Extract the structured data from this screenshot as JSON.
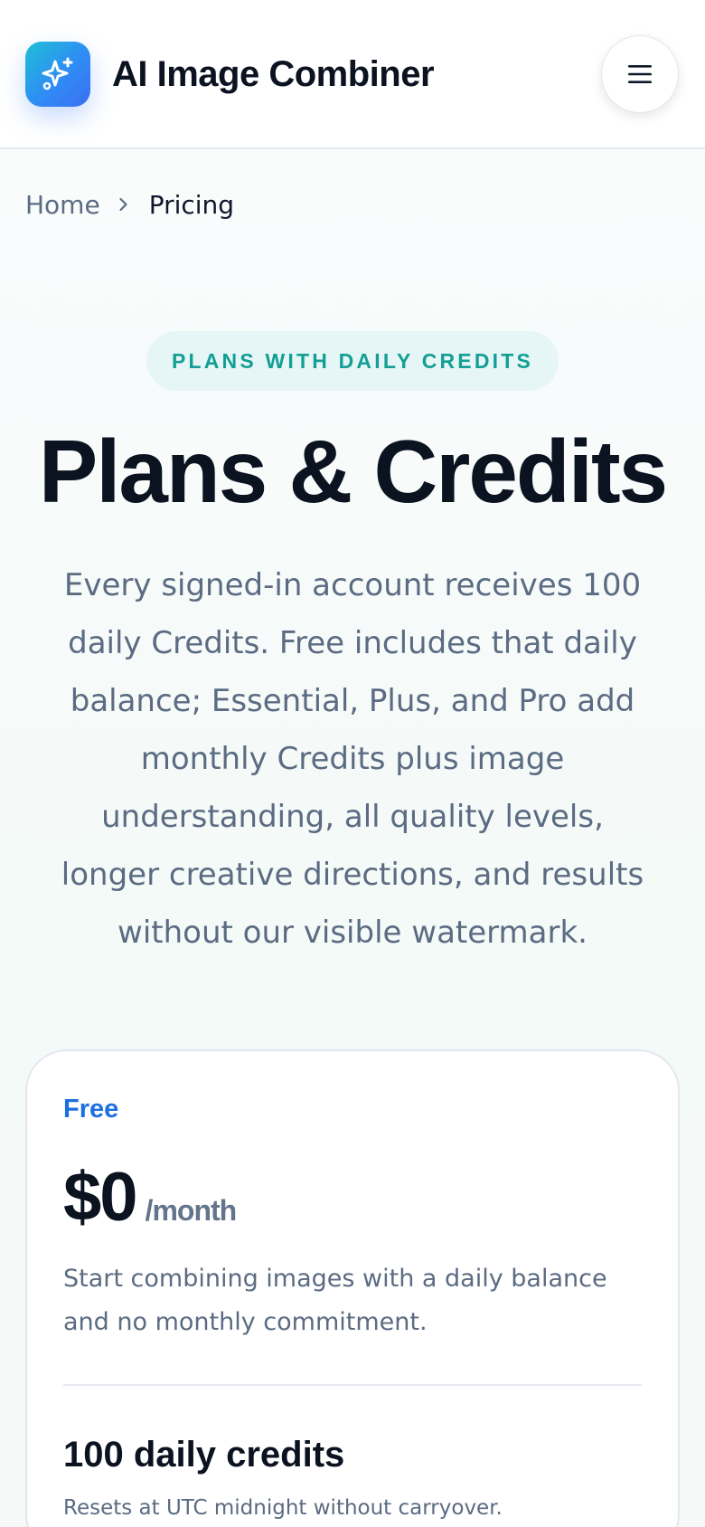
{
  "header": {
    "brand": "AI Image Combiner",
    "logo_icon": "sparkles-icon",
    "menu_icon": "hamburger-menu-icon",
    "accent": "#2f8cf5"
  },
  "breadcrumb": {
    "home": "Home",
    "separator_icon": "chevron-right-icon",
    "current": "Pricing"
  },
  "hero": {
    "eyebrow": "PLANS WITH DAILY CREDITS",
    "title": "Plans & Credits",
    "description": "Every signed-in account receives 100 daily Credits. Free includes that daily balance; Essential, Plus, and Pro add monthly Credits plus image understanding, all quality levels, longer creative directions, and results without our visible watermark."
  },
  "plans": [
    {
      "name": "Free",
      "price": "$0",
      "period": "/month",
      "description": "Start combining images with a daily balance and no monthly commitment.",
      "credits_title": "100 daily credits",
      "credits_note": "Resets at UTC midnight without carryover."
    }
  ],
  "colors": {
    "eyebrow_text": "#139f95",
    "eyebrow_bg": "#e6f6f6",
    "plan_name": "#1d6fe0",
    "body_text": "#5b6b82",
    "heading_text": "#0b1220"
  }
}
